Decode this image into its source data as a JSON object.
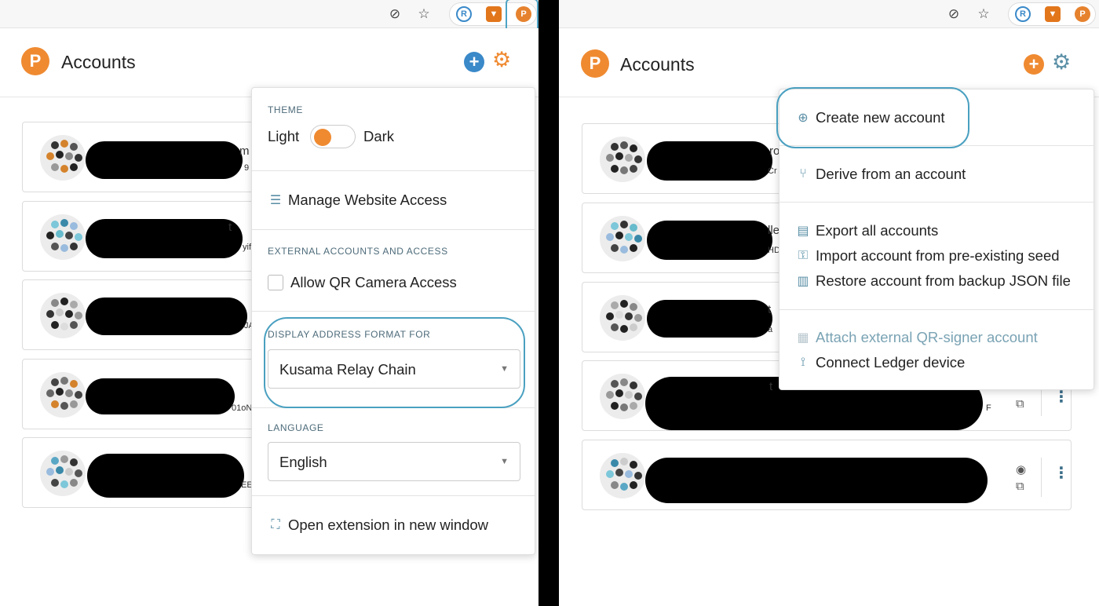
{
  "left": {
    "header": {
      "title": "Accounts"
    },
    "accounts": [
      {
        "address_fragment": "m",
        "sub_fragment": "9"
      },
      {
        "address_fragment": "t",
        "sub_fragment": "yif"
      },
      {
        "address_fragment": "",
        "sub_fragment": "JA"
      },
      {
        "address_fragment": "",
        "sub_fragment": "01oN"
      },
      {
        "address_fragment": "",
        "sub_fragment": "EE"
      }
    ],
    "settings_menu": {
      "theme_label": "THEME",
      "theme_light": "Light",
      "theme_dark": "Dark",
      "manage_access": "Manage Website Access",
      "external_label": "EXTERNAL ACCOUNTS AND ACCESS",
      "qr_camera": "Allow QR Camera Access",
      "address_format_label": "DISPLAY ADDRESS FORMAT FOR",
      "address_format_value": "Kusama Relay Chain",
      "language_label": "LANGUAGE",
      "language_value": "English",
      "open_window": "Open extension in new window"
    }
  },
  "right": {
    "header": {
      "title": "Accounts"
    },
    "accounts": [
      {
        "address_fragment": "rog",
        "sub_fragment": "Cr"
      },
      {
        "address_fragment": "lle",
        "sub_fragment": "HD"
      },
      {
        "address_fragment": "t",
        "sub_fragment": "a"
      },
      {
        "address_fragment": "t",
        "sub_fragment": "F"
      },
      {
        "address_fragment": "",
        "sub_fragment": ""
      }
    ],
    "add_menu": {
      "create": "Create new account",
      "derive": "Derive from an account",
      "export_all": "Export all accounts",
      "import_seed": "Import account from pre-existing seed",
      "restore_json": "Restore account from backup JSON file",
      "attach_qr": "Attach external QR-signer account",
      "ledger": "Connect Ledger device"
    }
  },
  "icons": {
    "eye_off": "eye-off-icon",
    "star": "star-icon",
    "ext_r": "R",
    "ext_fox": "fox-icon",
    "ext_polkadot": "P",
    "logo": "P"
  },
  "colors": {
    "accent": "#ef8a31",
    "highlight": "#4aa0c0",
    "plus_blue": "#3a89c9"
  }
}
